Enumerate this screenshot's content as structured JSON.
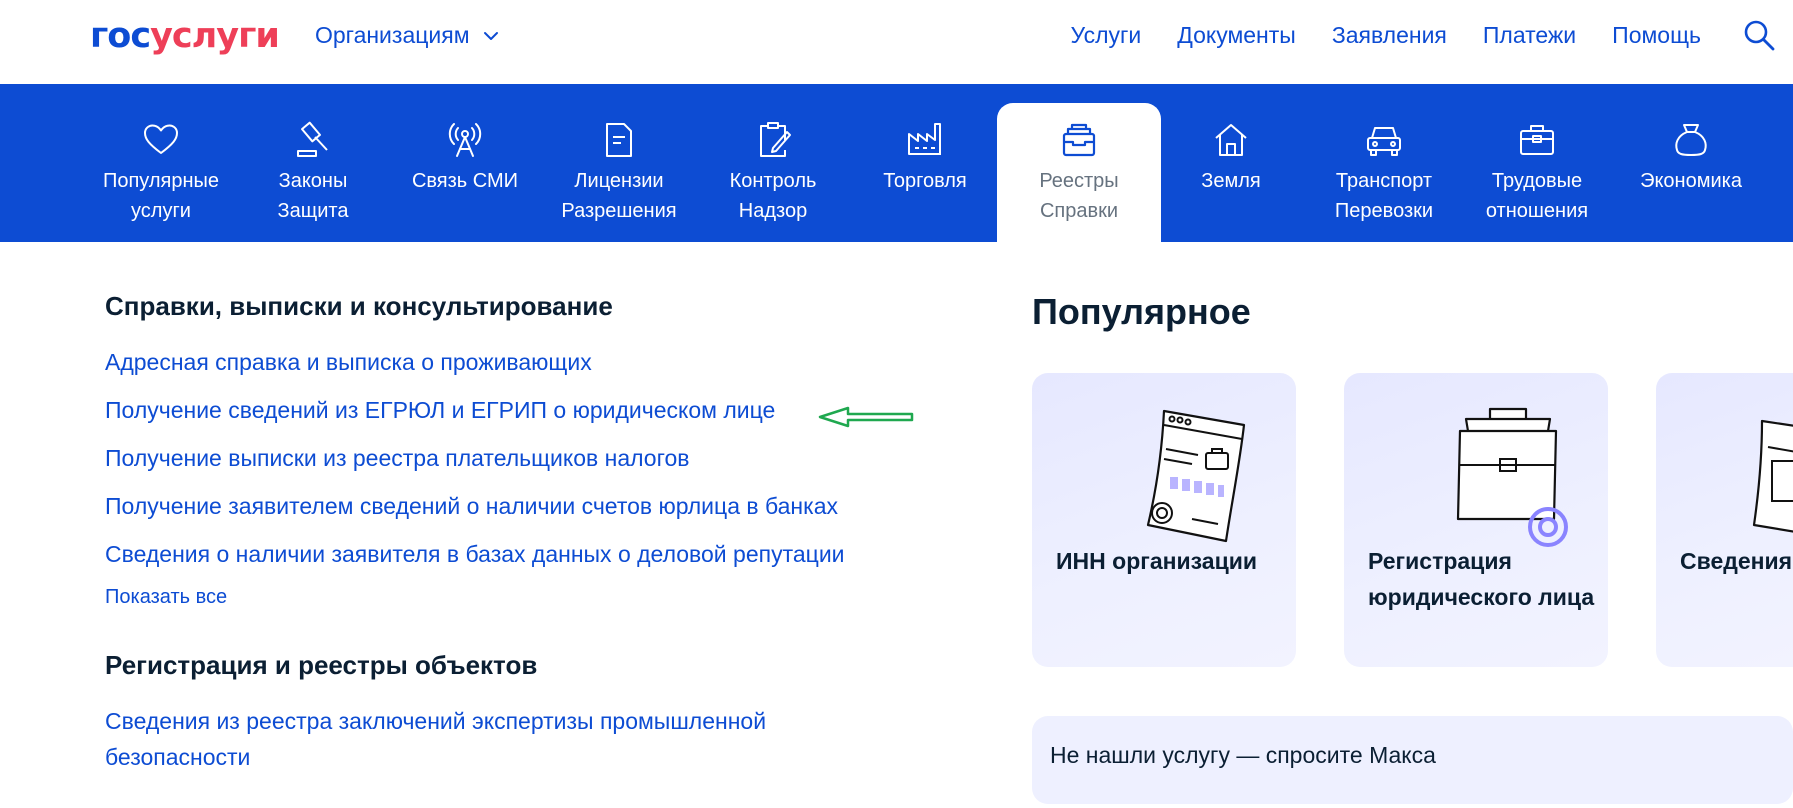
{
  "header": {
    "logo_part1": "гос",
    "logo_part2": "услуги",
    "org_dropdown": "Организациям",
    "nav": [
      "Услуги",
      "Документы",
      "Заявления",
      "Платежи",
      "Помощь"
    ]
  },
  "categories": [
    {
      "line1": "Популярные",
      "line2": "услуги",
      "icon": "heart-icon"
    },
    {
      "line1": "Законы",
      "line2": "Защита",
      "icon": "gavel-icon"
    },
    {
      "line1": "Связь СМИ",
      "line2": "",
      "icon": "antenna-icon"
    },
    {
      "line1": "Лицензии",
      "line2": "Разрешения",
      "icon": "document-icon"
    },
    {
      "line1": "Контроль",
      "line2": "Надзор",
      "icon": "clipboard-pen-icon"
    },
    {
      "line1": "Торговля",
      "line2": "",
      "icon": "factory-icon"
    },
    {
      "line1": "Реестры",
      "line2": "Справки",
      "icon": "registry-icon",
      "active": true
    },
    {
      "line1": "Земля",
      "line2": "",
      "icon": "house-icon"
    },
    {
      "line1": "Транспорт",
      "line2": "Перевозки",
      "icon": "car-icon"
    },
    {
      "line1": "Трудовые",
      "line2": "отношения",
      "icon": "briefcase-icon"
    },
    {
      "line1": "Экономика",
      "line2": "",
      "icon": "money-bag-icon"
    }
  ],
  "section1": {
    "title": "Справки, выписки и консультирование",
    "links": [
      "Адресная справка и выписка о проживающих",
      "Получение сведений из ЕГРЮЛ и ЕГРИП о юридическом лице",
      "Получение выписки из реестра плательщиков налогов",
      "Получение заявителем сведений о наличии счетов юрлица в банках",
      "Сведения о наличии заявителя в базах данных о деловой репутации"
    ],
    "show_all": "Показать все"
  },
  "section2": {
    "title": "Регистрация и реестры объектов",
    "links": [
      "Сведения из реестра заключений экспертизы промышленной безопасности"
    ]
  },
  "popular": {
    "title": "Популярное",
    "cards": [
      {
        "title": "ИНН организации",
        "icon": "document-certificate-icon"
      },
      {
        "title": "Регистрация юридического лица",
        "icon": "briefcase-icon"
      },
      {
        "title": "Сведения об обязательных отчислениях",
        "icon": "document-icon"
      }
    ]
  },
  "ask": {
    "text": "Не нашли услугу — спросите Макса"
  },
  "annotation": {
    "arrow_color": "#1fa84f"
  }
}
